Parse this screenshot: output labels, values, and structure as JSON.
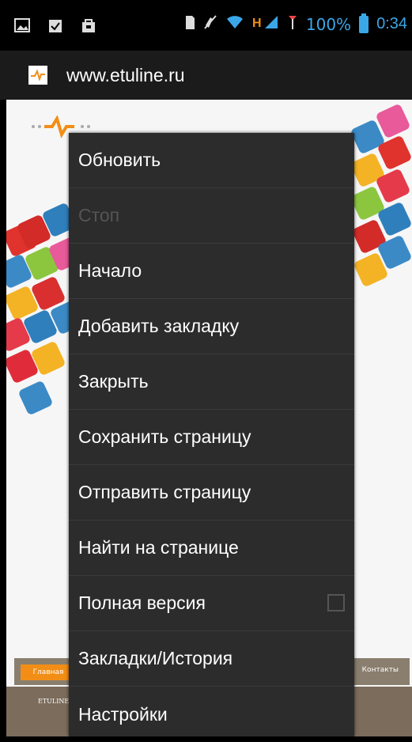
{
  "status_bar": {
    "battery_percent": "100%",
    "time": "0:34",
    "network": "H"
  },
  "url_bar": {
    "url": "www.etuline.ru"
  },
  "page": {
    "nav_active": "Главная",
    "nav_right": "Контакты",
    "footer_text": "ETULINE"
  },
  "menu": {
    "items": [
      {
        "label": "Обновить",
        "enabled": true
      },
      {
        "label": "Стоп",
        "enabled": false
      },
      {
        "label": "Начало",
        "enabled": true
      },
      {
        "label": "Добавить закладку",
        "enabled": true
      },
      {
        "label": "Закрыть",
        "enabled": true
      },
      {
        "label": "Сохранить страницу",
        "enabled": true
      },
      {
        "label": "Отправить страницу",
        "enabled": true
      },
      {
        "label": "Найти на странице",
        "enabled": true
      },
      {
        "label": "Полная версия",
        "enabled": true,
        "checked": false
      },
      {
        "label": "Закладки/История",
        "enabled": true
      },
      {
        "label": "Настройки",
        "enabled": true
      }
    ]
  },
  "colors": {
    "accent": "#3aa7e8",
    "menu_bg": "#2c2c2c",
    "orange": "#f28e16"
  }
}
